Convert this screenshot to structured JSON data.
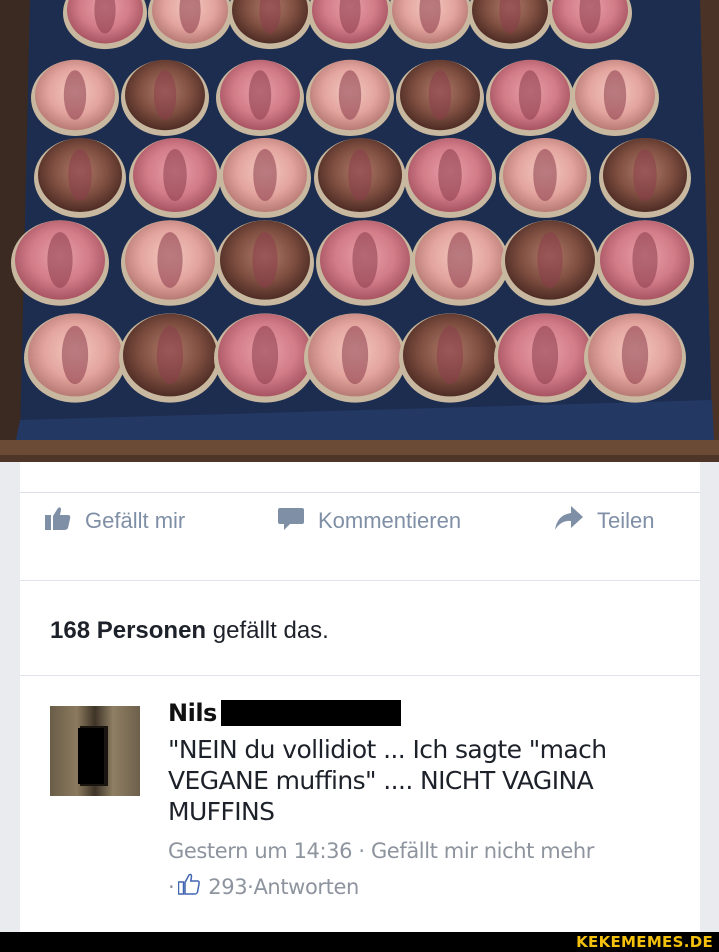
{
  "photo": {
    "icon": "photo-of-cupcakes-on-tray"
  },
  "actions": {
    "like_label": "Gefällt mir",
    "comment_label": "Kommentieren",
    "share_label": "Teilen",
    "icons": [
      "thumbs-up-icon",
      "comment-bubble-icon",
      "share-arrow-icon"
    ],
    "icon_color": "#7f8fa6"
  },
  "likes": {
    "count_text": "168 Personen",
    "suffix": " gefällt das."
  },
  "comment": {
    "author": "Nils",
    "text": "\"NEIN du vollidiot ... Ich sagte \"mach VEGANE muffins\" .... NICHT VAGINA MUFFINS",
    "timestamp": "Gestern um 14:36",
    "separator": " · ",
    "unlike_label": "Gefällt mir nicht mehr",
    "bullet": "·",
    "like_count": "293",
    "reply_separator": " · ",
    "reply_label": "Antworten"
  },
  "watermark": {
    "text": "KEKEMEMES.DE",
    "color": "#f4c20d"
  }
}
